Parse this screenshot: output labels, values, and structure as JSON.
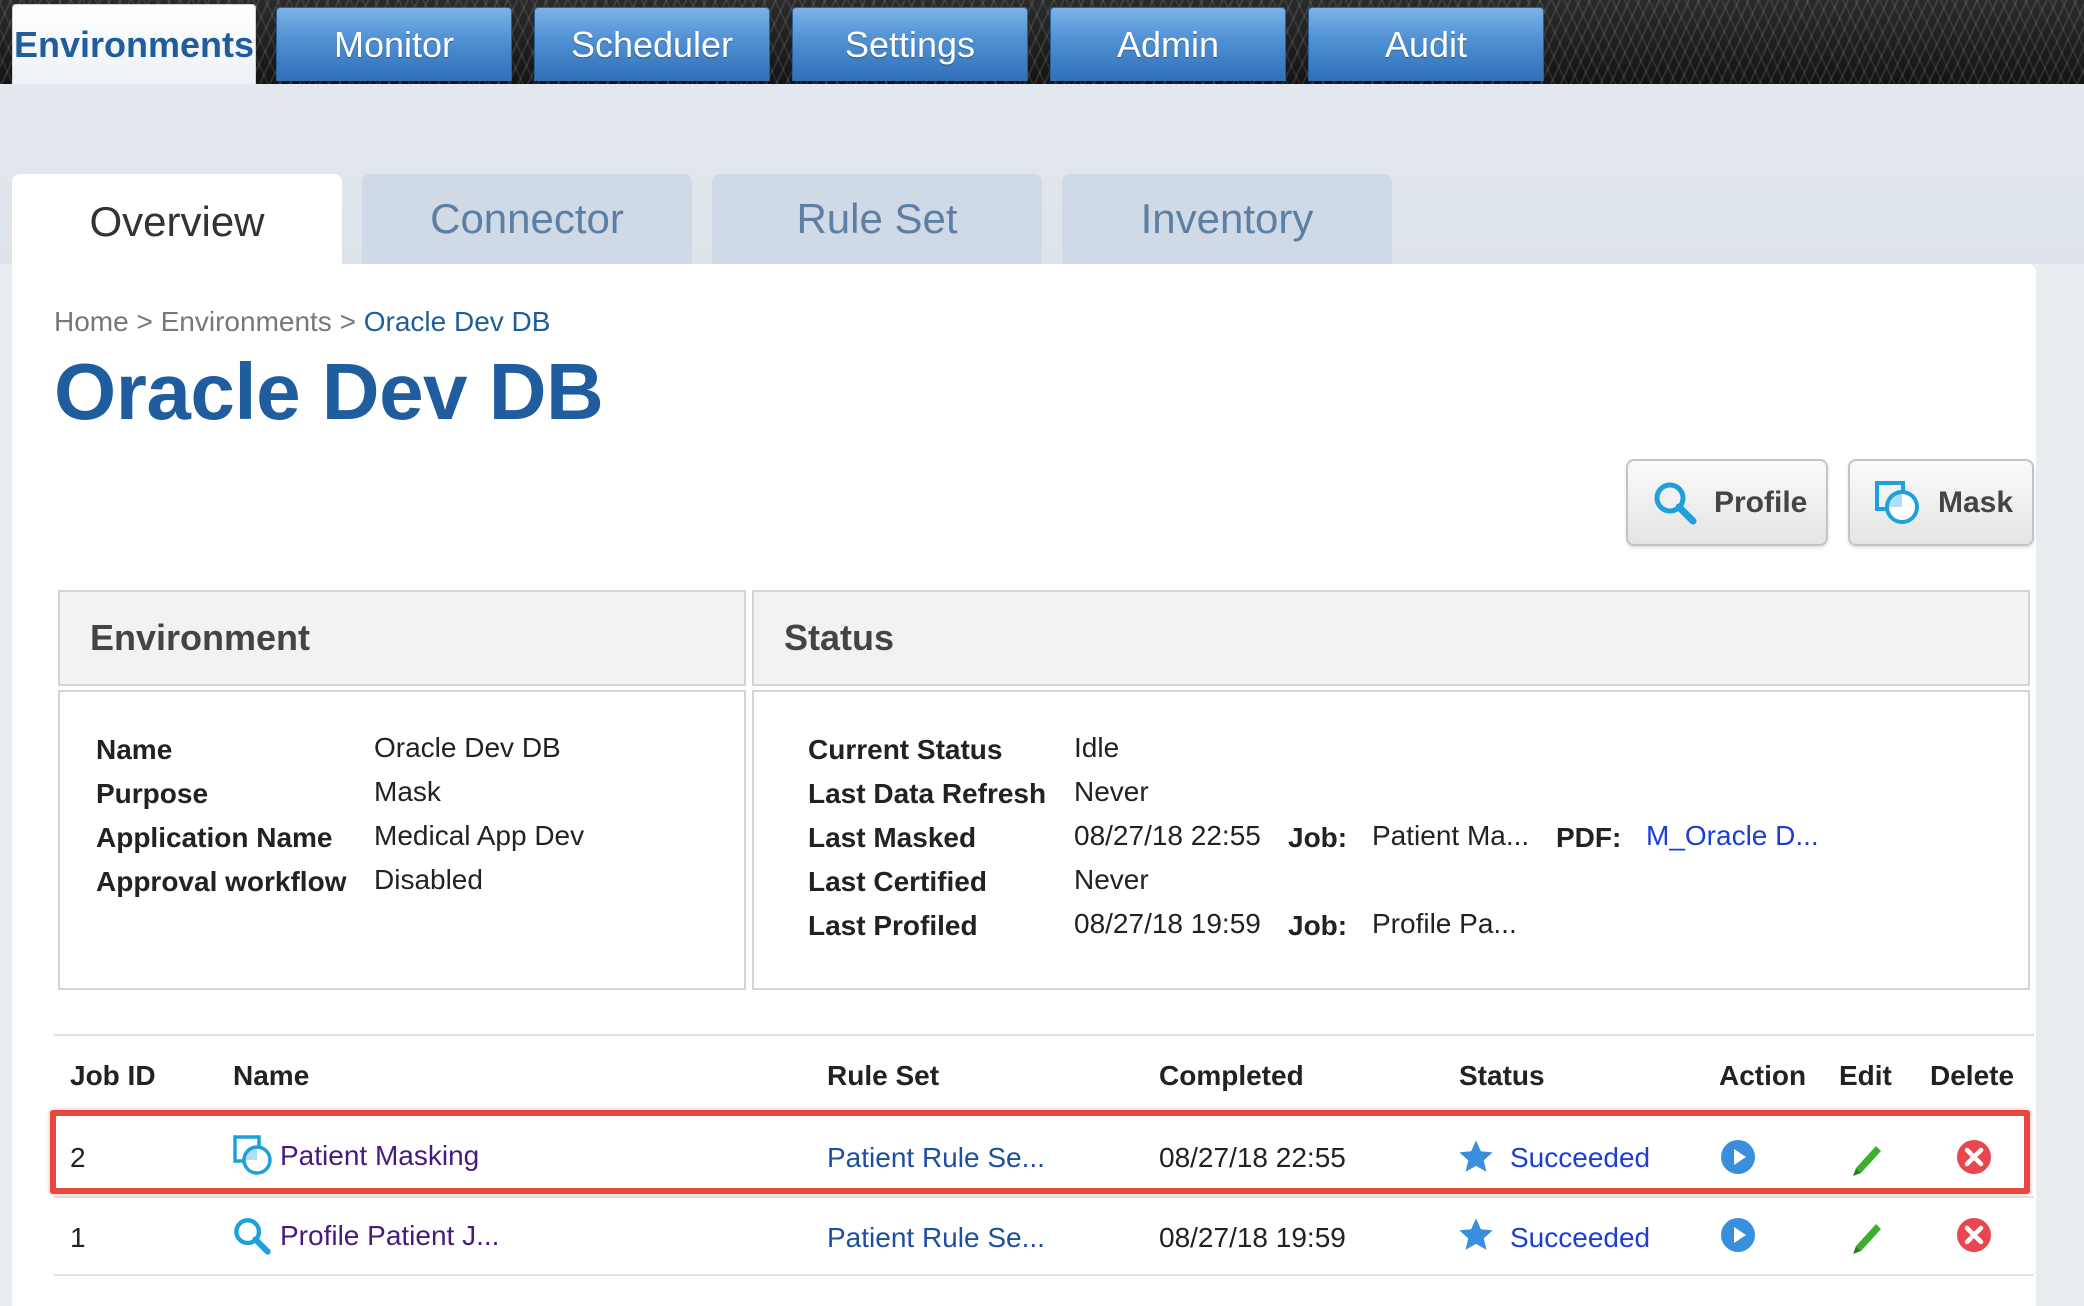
{
  "nav": {
    "tabs": [
      {
        "label": "Environments",
        "active": true
      },
      {
        "label": "Monitor"
      },
      {
        "label": "Scheduler"
      },
      {
        "label": "Settings"
      },
      {
        "label": "Admin"
      },
      {
        "label": "Audit"
      }
    ]
  },
  "subnav": {
    "tabs": [
      {
        "label": "Overview",
        "active": true
      },
      {
        "label": "Connector"
      },
      {
        "label": "Rule Set"
      },
      {
        "label": "Inventory"
      }
    ]
  },
  "breadcrumb": {
    "home": "Home",
    "sep1": ">",
    "environments": "Environments",
    "sep2": ">",
    "current": "Oracle Dev DB"
  },
  "page": {
    "title": "Oracle Dev DB"
  },
  "actions": {
    "profile_label": "Profile",
    "mask_label": "Mask"
  },
  "environment": {
    "heading": "Environment",
    "fields": [
      {
        "key": "Name",
        "value": "Oracle Dev DB"
      },
      {
        "key": "Purpose",
        "value": "Mask"
      },
      {
        "key": "Application Name",
        "value": "Medical App Dev"
      },
      {
        "key": "Approval workflow",
        "value": "Disabled"
      }
    ]
  },
  "status": {
    "heading": "Status",
    "current_status": {
      "key": "Current Status",
      "value": "Idle"
    },
    "last_data_refresh": {
      "key": "Last Data Refresh",
      "value": "Never"
    },
    "last_masked": {
      "key": "Last Masked",
      "value": "08/27/18 22:55",
      "job_key": "Job:",
      "job": "Patient Ma...",
      "pdf_key": "PDF:",
      "pdf": "M_Oracle D..."
    },
    "last_certified": {
      "key": "Last Certified",
      "value": "Never"
    },
    "last_profiled": {
      "key": "Last Profiled",
      "value": "08/27/18 19:59",
      "job_key": "Job:",
      "job": "Profile Pa..."
    }
  },
  "jobs": {
    "headers": {
      "job_id": "Job ID",
      "name": "Name",
      "rule_set": "Rule Set",
      "completed": "Completed",
      "status": "Status",
      "action": "Action",
      "edit": "Edit",
      "delete": "Delete"
    },
    "rows": [
      {
        "job_id": "2",
        "type_icon": "mask-icon",
        "name": "Patient Masking",
        "rule_set": "Patient Rule Se...",
        "completed": "08/27/18 22:55",
        "status": "Succeeded",
        "highlighted": true
      },
      {
        "job_id": "1",
        "type_icon": "search-icon",
        "name": "Profile Patient J...",
        "rule_set": "Patient Rule Se...",
        "completed": "08/27/18 19:59",
        "status": "Succeeded",
        "highlighted": false
      }
    ]
  },
  "colors": {
    "brand_blue": "#1f5d9e",
    "highlight_red": "#e8473f",
    "success_blue": "#1a3fd6",
    "edit_green": "#3cb02d",
    "delete_red": "#e8474f"
  }
}
